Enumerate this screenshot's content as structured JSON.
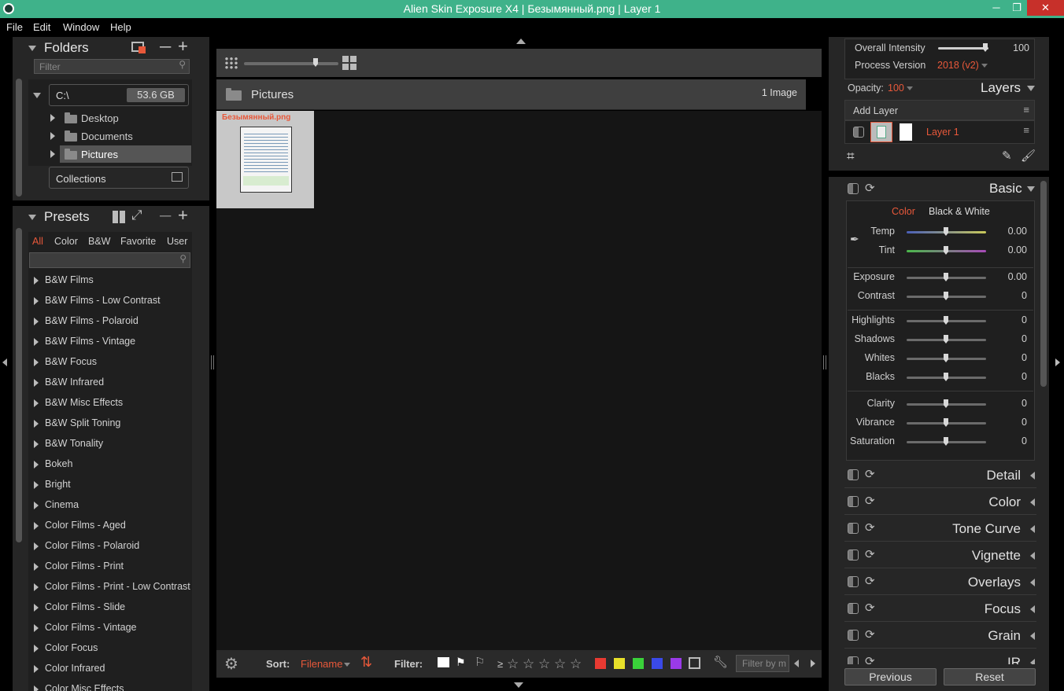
{
  "window": {
    "title": "Alien Skin Exposure X4 | Безымянный.png | Layer 1"
  },
  "menu": [
    "File",
    "Edit",
    "Window",
    "Help"
  ],
  "folders": {
    "header": "Folders",
    "filter_placeholder": "Filter",
    "drive": {
      "name": "C:\\",
      "free": "53.6 GB"
    },
    "items": [
      "Desktop",
      "Documents",
      "Pictures"
    ],
    "collections": "Collections"
  },
  "presets": {
    "header": "Presets",
    "tabs": [
      "All",
      "Color",
      "B&W",
      "Favorite",
      "User"
    ],
    "items": [
      "B&W Films",
      "B&W Films - Low Contrast",
      "B&W Films - Polaroid",
      "B&W Films - Vintage",
      "B&W Focus",
      "B&W Infrared",
      "B&W Misc Effects",
      "B&W Split Toning",
      "B&W Tonality",
      "Bokeh",
      "Bright",
      "Cinema",
      "Color Films - Aged",
      "Color Films - Polaroid",
      "Color Films - Print",
      "Color Films - Print - Low Contrast",
      "Color Films - Slide",
      "Color Films - Vintage",
      "Color Focus",
      "Color Infrared",
      "Color Misc Effects"
    ]
  },
  "browser": {
    "folder_name": "Pictures",
    "count": "1 Image",
    "thumb_label": "Безымянный.png",
    "thumb_size_level": 0.75
  },
  "bottombar": {
    "sort_label": "Sort:",
    "sort_value": "Filename",
    "filter_label": "Filter:",
    "rating_op": "≥",
    "search_placeholder": "Filter by m",
    "color_labels": [
      "#e83a32",
      "#e8e02a",
      "#3ad23a",
      "#3a4ae8",
      "#9a3ae8"
    ]
  },
  "layers": {
    "intensity_label": "Overall Intensity",
    "intensity_value": "100",
    "intensity_level": 1.0,
    "process_label": "Process Version",
    "process_value": "2018 (v2)",
    "opacity_label": "Opacity:",
    "opacity_value": "100",
    "header": "Layers",
    "add_layer": "Add Layer",
    "layer_name": "Layer 1"
  },
  "basic": {
    "header": "Basic",
    "mode_color": "Color",
    "mode_bw": "Black & White",
    "rows": [
      {
        "label": "Temp",
        "value": "0.00"
      },
      {
        "label": "Tint",
        "value": "0.00"
      },
      {
        "label": "Exposure",
        "value": "0.00"
      },
      {
        "label": "Contrast",
        "value": "0"
      },
      {
        "label": "Highlights",
        "value": "0"
      },
      {
        "label": "Shadows",
        "value": "0"
      },
      {
        "label": "Whites",
        "value": "0"
      },
      {
        "label": "Blacks",
        "value": "0"
      },
      {
        "label": "Clarity",
        "value": "0"
      },
      {
        "label": "Vibrance",
        "value": "0"
      },
      {
        "label": "Saturation",
        "value": "0"
      }
    ]
  },
  "sections": [
    "Detail",
    "Color",
    "Tone Curve",
    "Vignette",
    "Overlays",
    "Focus",
    "Grain",
    "IR"
  ],
  "actions": {
    "previous": "Previous",
    "reset": "Reset"
  },
  "colors": {
    "accent": "#e8583a",
    "titlebar": "#3fb28a"
  }
}
